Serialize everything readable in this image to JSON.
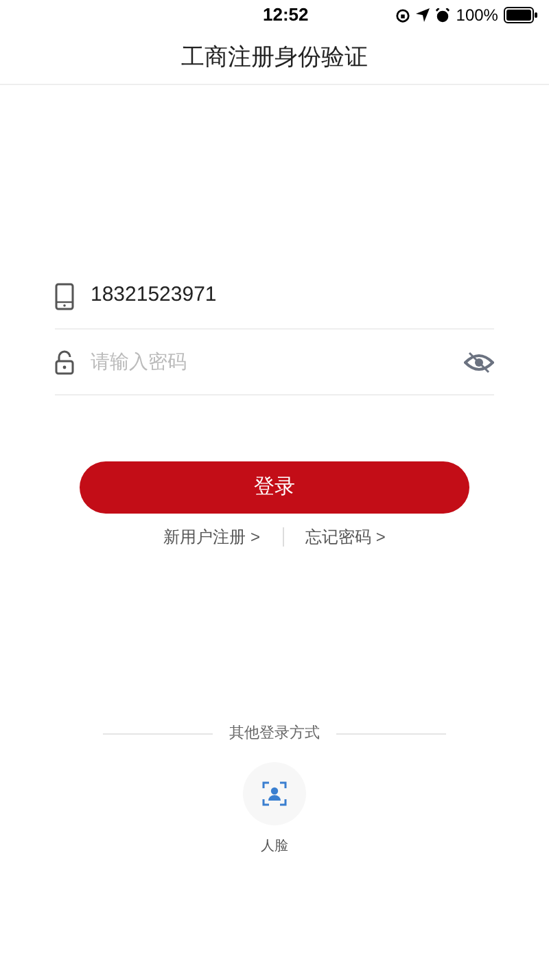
{
  "status_bar": {
    "time": "12:52",
    "battery": "100%"
  },
  "header": {
    "title": "工商注册身份验证"
  },
  "form": {
    "phone": {
      "value": "18321523971"
    },
    "password": {
      "placeholder": "请输入密码",
      "visible": false
    }
  },
  "login_button": "登录",
  "links": [
    "新用户注册 >",
    "忘记密码 >"
  ],
  "other_login": {
    "heading": "其他登录方式",
    "options": [
      {
        "label": "人脸"
      }
    ]
  }
}
